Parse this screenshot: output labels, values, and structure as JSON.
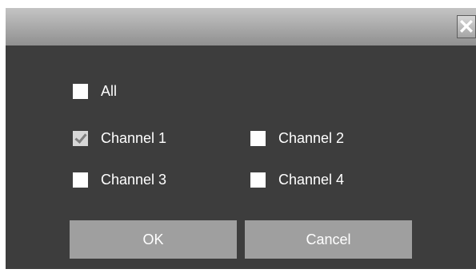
{
  "dialog": {
    "close_glyph": "✕",
    "checkboxes": {
      "all": {
        "label": "All",
        "checked": false
      },
      "channel1": {
        "label": "Channel 1",
        "checked": true
      },
      "channel2": {
        "label": "Channel 2",
        "checked": false
      },
      "channel3": {
        "label": "Channel 3",
        "checked": false
      },
      "channel4": {
        "label": "Channel 4",
        "checked": false
      }
    },
    "buttons": {
      "ok": "OK",
      "cancel": "Cancel"
    }
  },
  "colors": {
    "dialog_background": "#3d3d3d",
    "button_background": "#9f9f9f",
    "text": "#ffffff"
  }
}
